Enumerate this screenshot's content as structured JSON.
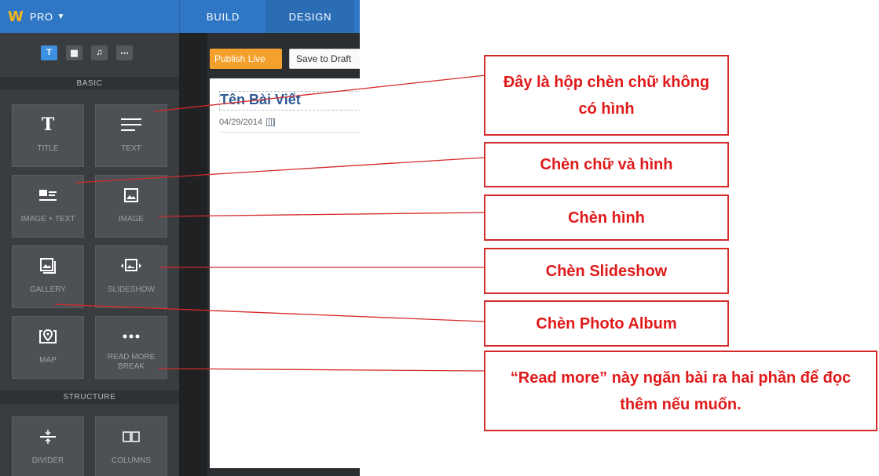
{
  "header": {
    "logo": "W",
    "plan": "PRO",
    "tabs": [
      "BUILD",
      "DESIGN"
    ]
  },
  "sidebar": {
    "tools": [
      {
        "icon": "text-icon",
        "glyph": "T"
      },
      {
        "icon": "layout-icon",
        "glyph": "▦"
      },
      {
        "icon": "music-icon",
        "glyph": "♫"
      },
      {
        "icon": "more-icon",
        "glyph": "⋯"
      }
    ],
    "sections": {
      "basic": "BASIC",
      "structure": "STRUCTURE"
    },
    "elements": [
      {
        "label": "TITLE",
        "icon": "title-icon"
      },
      {
        "label": "TEXT",
        "icon": "text-lines-icon"
      },
      {
        "label": "IMAGE + TEXT",
        "icon": "image-text-icon"
      },
      {
        "label": "IMAGE",
        "icon": "image-icon"
      },
      {
        "label": "GALLERY",
        "icon": "gallery-icon"
      },
      {
        "label": "SLIDESHOW",
        "icon": "slideshow-icon"
      },
      {
        "label": "MAP",
        "icon": "map-pin-icon"
      },
      {
        "label": "READ MORE BREAK",
        "icon": "ellipsis-icon"
      },
      {
        "label": "DIVIDER",
        "icon": "divider-icon"
      },
      {
        "label": "COLUMNS",
        "icon": "columns-icon"
      }
    ]
  },
  "editor": {
    "publish_label": "Publish Live",
    "draft_label": "Save to Draft",
    "post_title": "Tên Bài Viết",
    "post_date": "04/29/2014"
  },
  "callouts": [
    "Đây là hộp chèn chữ không có hình",
    "Chèn chữ và hình",
    "Chèn hình",
    "Chèn Slideshow",
    "Chèn Photo Album",
    "“Read more” này ngăn bài ra hai phần để đọc thêm nếu muốn."
  ],
  "colors": {
    "topbar": "#2f77c4",
    "publish": "#f3a12c",
    "callout_red": "#e01a1a",
    "logo": "#f4b41a"
  }
}
